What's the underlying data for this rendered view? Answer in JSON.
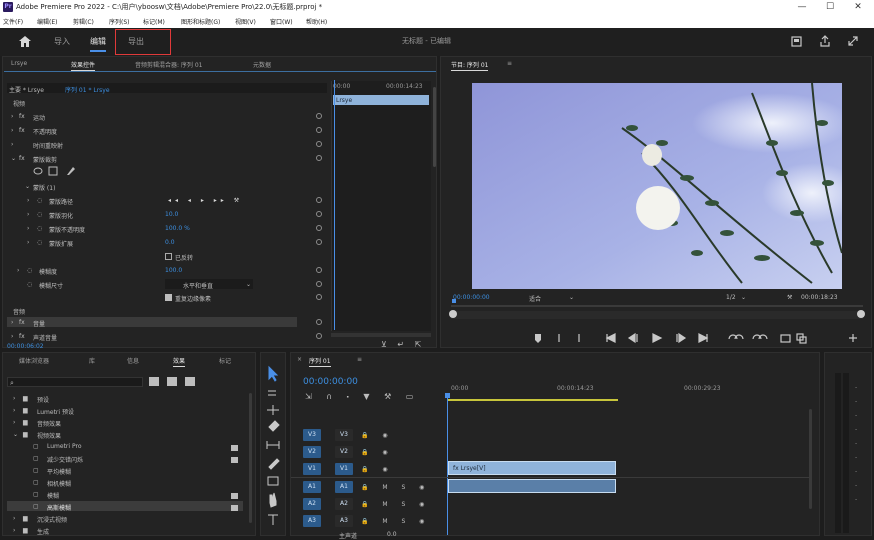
{
  "title_bar": {
    "app_icon": "Pr",
    "title": "Adobe Premiere Pro 2022 - C:\\用户\\yboosw\\文档\\Adobe\\Premiere Pro\\22.0\\无标题.prproj *",
    "minimize": "—",
    "maximize": "☐",
    "close": "✕"
  },
  "menu": [
    "文件(F)",
    "编辑(E)",
    "剪辑(C)",
    "序列(S)",
    "标记(M)",
    "图形和标题(G)",
    "视图(V)",
    "窗口(W)",
    "帮助(H)"
  ],
  "workspace": {
    "home_icon": "home-icon",
    "tabs": [
      "导入",
      "编辑",
      "导出"
    ],
    "active_tab": "编辑",
    "center_title": "无标题 - 已编辑",
    "right_icons": [
      "full-screen-icon",
      "share-icon",
      "expand-icon"
    ]
  },
  "effect_controls": {
    "tabs": [
      "Lrsye",
      "效果控件",
      "音频剪辑混合器: 序列 01",
      "元数据"
    ],
    "master_clip": "主要 * Lrsye",
    "sequence_clip": "序列 01 * Lrsye",
    "video_header": "视频",
    "rows": [
      "运动",
      "不透明度",
      "时间重映射",
      "蒙版裁剪"
    ],
    "mask_group": "蒙版 (1)",
    "mask_props": [
      "蒙版路径",
      "蒙版羽化",
      "蒙版不透明度",
      "蒙版扩展"
    ],
    "mask_values": [
      "",
      "10.0",
      "100.0 %",
      "0.0"
    ],
    "inverted_label": "已反转",
    "blend_label": "模糊度",
    "blend_value": "100.0",
    "mask_size_label": "模糊尺寸",
    "mask_size_value": "水平和垂直",
    "repeat_edge_label": "重复边缘像素",
    "audio_header": "音频",
    "audio_rows": [
      "音量",
      "声道音量"
    ],
    "timecode_left": "00:00:06:02",
    "mini_time_start": "00:00",
    "mini_time_end": "00:00:14:23",
    "mini_clip_label": "Lrsye"
  },
  "program_monitor": {
    "tab": "节目: 序列 01",
    "timecode": "00:00:00:00",
    "fit": "适合",
    "quality": "1/2",
    "duration": "00:00:18:23",
    "controls": [
      "marker-icon",
      "in-point-icon",
      "out-point-icon",
      "goto-in-icon",
      "step-back-icon",
      "play-icon",
      "step-forward-icon",
      "goto-out-icon",
      "insert-icon",
      "overwrite-icon",
      "lift-icon",
      "extract-icon",
      "camera-icon",
      "export-frame-icon",
      "add-icon"
    ]
  },
  "project": {
    "tabs": [
      "媒体浏览器",
      "库",
      "信息",
      "效果",
      "标记"
    ],
    "active_tab": "效果",
    "search_placeholder": "",
    "items": [
      "预设",
      "Lumetri 预设",
      "音频效果",
      "音频过渡",
      "视频效果",
      "视频过渡",
      "沉浸式视频",
      "其他"
    ],
    "sub_items": [
      "Lumetri Pro",
      "减少交错闪烁",
      "平均模糊",
      "相机模糊",
      "模糊",
      "高斯模糊"
    ],
    "bottom_items": [
      "沉浸式视频",
      "生成",
      "主题"
    ]
  },
  "timeline": {
    "tab": "序列 01",
    "timecode": "00:00:00:00",
    "ruler": [
      "00:00",
      "00:00:14:23",
      "00:00:29:23"
    ],
    "tracks": [
      "V3",
      "V2",
      "V1",
      "A1",
      "A2",
      "A3"
    ],
    "clip_v1": "fx Lrsye[V]",
    "clip_a1": "",
    "master_label": "主声道",
    "master_value": "0.0"
  },
  "colors": {
    "accent": "#4a8fe7",
    "clip_video": "#8fb3da",
    "clip_audio": "#5a7fa8",
    "highlight_red": "#e03a3a"
  }
}
